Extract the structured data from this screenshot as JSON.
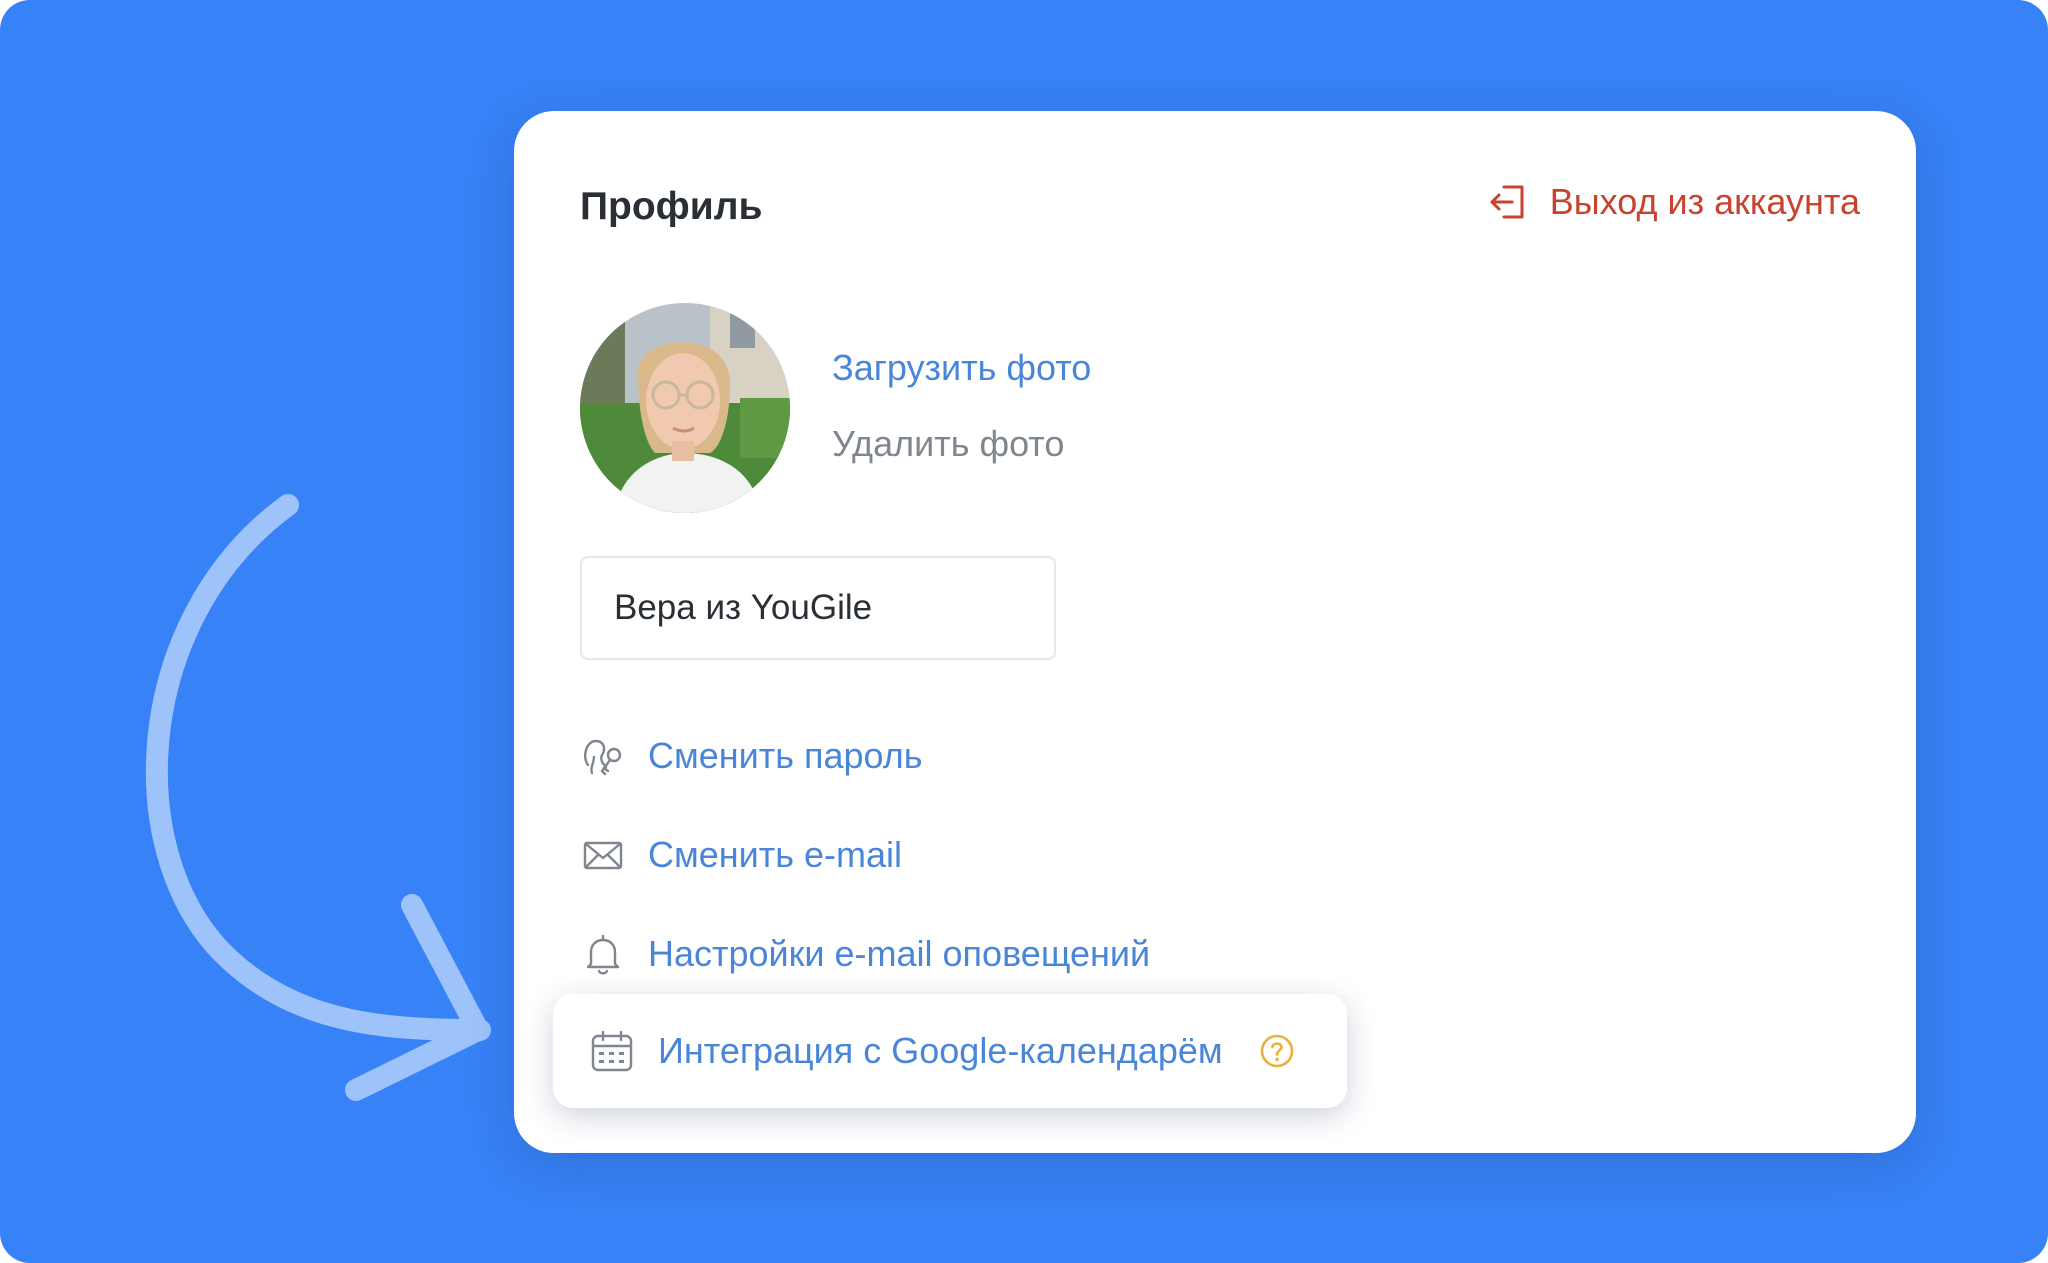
{
  "profile": {
    "title": "Профиль",
    "logout_label": "Выход из аккаунта",
    "upload_photo": "Загрузить фото",
    "delete_photo": "Удалить фото",
    "name_value": "Вера из YouGile",
    "menu": {
      "change_password": "Сменить пароль",
      "change_email": "Сменить e-mail",
      "email_notifications": "Настройки e-mail оповещений",
      "google_calendar": "Интеграция с Google-календарём"
    }
  },
  "icons": {
    "logout": "logout-icon",
    "password": "key-icon",
    "email": "envelope-icon",
    "notifications": "bell-icon",
    "calendar": "calendar-icon",
    "help": "question-circle-icon"
  },
  "colors": {
    "background": "#3782f6",
    "link": "#4a86d8",
    "logout": "#c8432e",
    "help": "#e8b23a",
    "arrow": "#9ec3fb"
  }
}
